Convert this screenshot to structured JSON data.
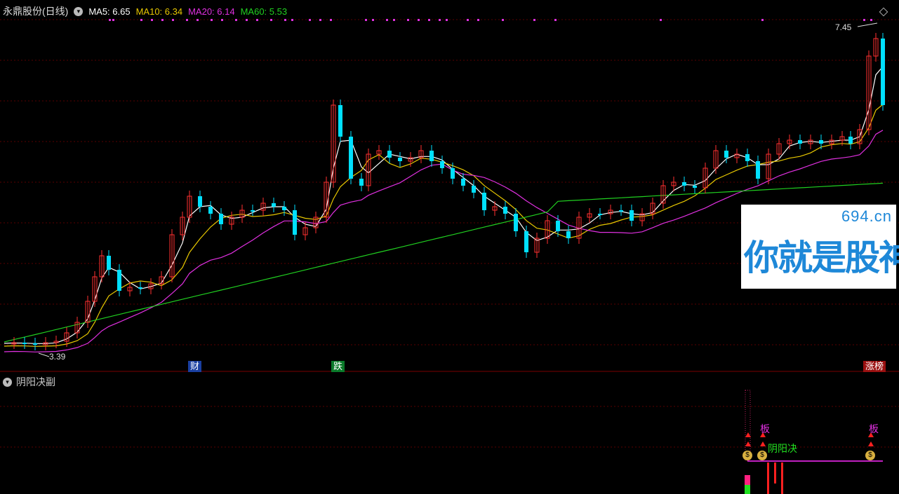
{
  "header": {
    "stock_name": "永鼎股份(日线)",
    "ma5": "MA5: 6.65",
    "ma10": "MA10: 6.34",
    "ma20": "MA20: 6.14",
    "ma60": "MA60: 5.53",
    "colors": {
      "ma5": "#ffffff",
      "ma10": "#e8c800",
      "ma20": "#e030e0",
      "ma60": "#20d020"
    }
  },
  "annotations": {
    "high_label": "7.45",
    "low_label": "3.39",
    "event_cai": "财",
    "event_die": "跌",
    "event_zhangbang": "涨榜"
  },
  "sub_panel": {
    "title": "阴阳决副",
    "label_ban_1": "板",
    "label_ban_2": "板",
    "label_yinyang": "阴阳决",
    "money_icon_1": "$",
    "money_icon_2": "$",
    "money_icon_3": "$"
  },
  "watermark": {
    "domain": "694.cn",
    "slogan": "你就是股神"
  }
}
